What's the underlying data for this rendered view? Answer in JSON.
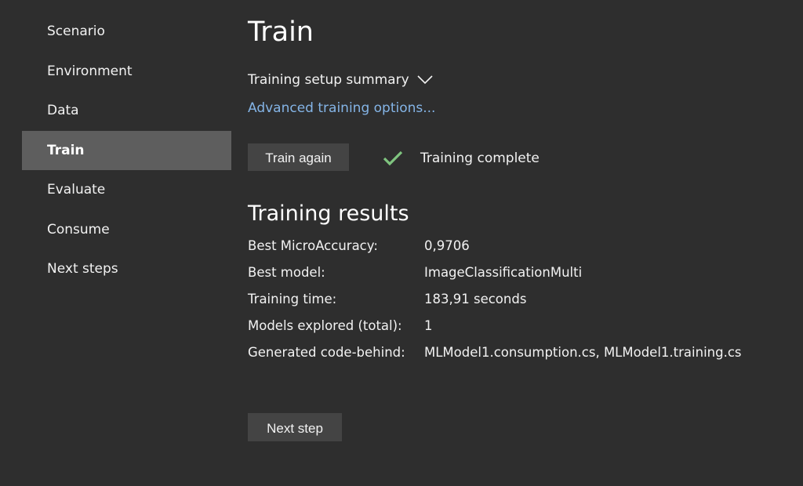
{
  "sidebar": {
    "items": [
      {
        "label": "Scenario"
      },
      {
        "label": "Environment"
      },
      {
        "label": "Data"
      },
      {
        "label": "Train"
      },
      {
        "label": "Evaluate"
      },
      {
        "label": "Consume"
      },
      {
        "label": "Next steps"
      }
    ],
    "active": "Train"
  },
  "main": {
    "title": "Train",
    "summary_label": "Training setup summary",
    "advanced_link": "Advanced training options...",
    "train_again_label": "Train again",
    "status_text": "Training complete",
    "results_title": "Training results",
    "results": [
      {
        "label": "Best MicroAccuracy:",
        "value": "0,9706"
      },
      {
        "label": "Best model:",
        "value": "ImageClassificationMulti"
      },
      {
        "label": "Training time:",
        "value": "183,91 seconds"
      },
      {
        "label": "Models explored (total):",
        "value": "1"
      },
      {
        "label": "Generated code-behind:",
        "value": "MLModel1.consumption.cs, MLModel1.training.cs"
      }
    ],
    "next_step_label": "Next step"
  },
  "colors": {
    "background": "#2e2e2e",
    "sidebar_active": "#5e5e5e",
    "button": "#444444",
    "link": "#84b4e6",
    "check": "#7fc47f"
  },
  "icons": {
    "summary_toggle": "chevron-down-icon",
    "status": "checkmark-icon"
  }
}
